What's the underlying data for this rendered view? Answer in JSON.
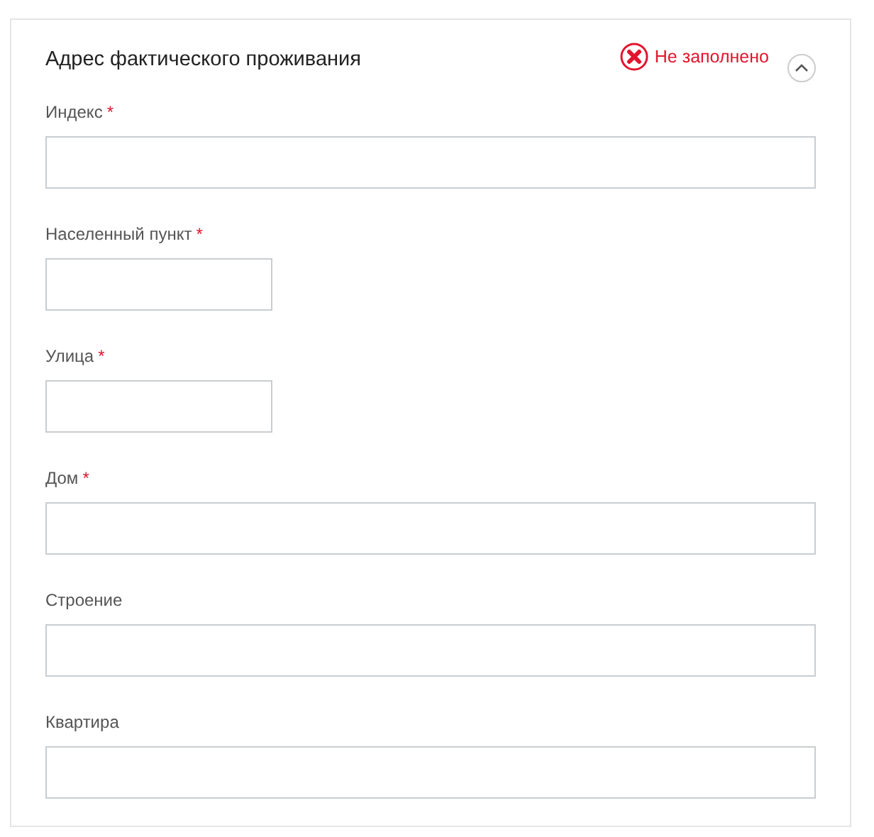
{
  "section": {
    "title": "Адрес фактического проживания",
    "status": {
      "text": "Не заполнено",
      "filled": false
    },
    "expanded": true
  },
  "fields": [
    {
      "label": "Индекс",
      "required": true,
      "kind": "wide"
    },
    {
      "label": "Населенный пункт",
      "required": true,
      "kind": "narrow"
    },
    {
      "label": "Улица",
      "required": true,
      "kind": "narrow"
    },
    {
      "label": "Дом",
      "required": true,
      "kind": "wide"
    },
    {
      "label": "Строение",
      "required": false,
      "kind": "wide"
    },
    {
      "label": "Квартира",
      "required": false,
      "kind": "wide"
    }
  ],
  "required_mark": "*"
}
